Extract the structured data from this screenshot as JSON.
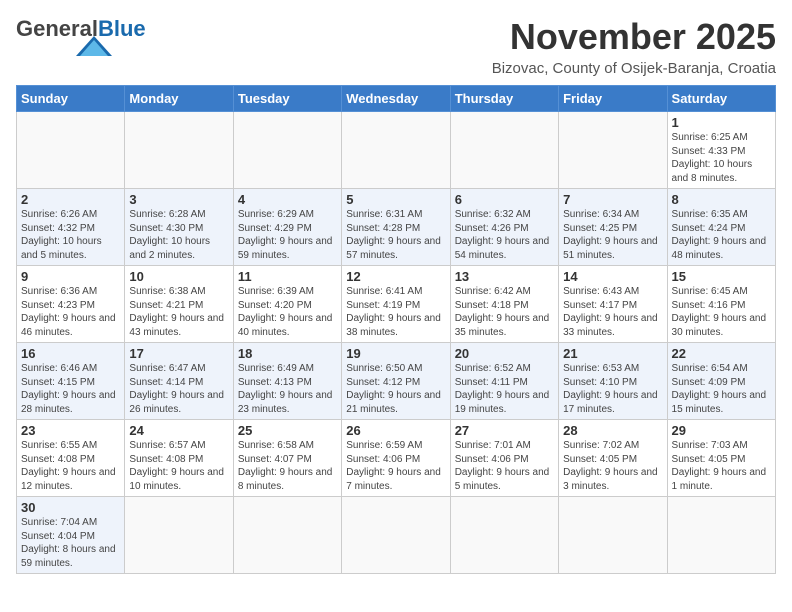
{
  "header": {
    "logo_general": "General",
    "logo_blue": "Blue",
    "month_title": "November 2025",
    "location": "Bizovac, County of Osijek-Baranja, Croatia"
  },
  "days_of_week": [
    "Sunday",
    "Monday",
    "Tuesday",
    "Wednesday",
    "Thursday",
    "Friday",
    "Saturday"
  ],
  "weeks": [
    [
      {
        "num": "",
        "info": ""
      },
      {
        "num": "",
        "info": ""
      },
      {
        "num": "",
        "info": ""
      },
      {
        "num": "",
        "info": ""
      },
      {
        "num": "",
        "info": ""
      },
      {
        "num": "",
        "info": ""
      },
      {
        "num": "1",
        "info": "Sunrise: 6:25 AM\nSunset: 4:33 PM\nDaylight: 10 hours and 8 minutes."
      }
    ],
    [
      {
        "num": "2",
        "info": "Sunrise: 6:26 AM\nSunset: 4:32 PM\nDaylight: 10 hours and 5 minutes."
      },
      {
        "num": "3",
        "info": "Sunrise: 6:28 AM\nSunset: 4:30 PM\nDaylight: 10 hours and 2 minutes."
      },
      {
        "num": "4",
        "info": "Sunrise: 6:29 AM\nSunset: 4:29 PM\nDaylight: 9 hours and 59 minutes."
      },
      {
        "num": "5",
        "info": "Sunrise: 6:31 AM\nSunset: 4:28 PM\nDaylight: 9 hours and 57 minutes."
      },
      {
        "num": "6",
        "info": "Sunrise: 6:32 AM\nSunset: 4:26 PM\nDaylight: 9 hours and 54 minutes."
      },
      {
        "num": "7",
        "info": "Sunrise: 6:34 AM\nSunset: 4:25 PM\nDaylight: 9 hours and 51 minutes."
      },
      {
        "num": "8",
        "info": "Sunrise: 6:35 AM\nSunset: 4:24 PM\nDaylight: 9 hours and 48 minutes."
      }
    ],
    [
      {
        "num": "9",
        "info": "Sunrise: 6:36 AM\nSunset: 4:23 PM\nDaylight: 9 hours and 46 minutes."
      },
      {
        "num": "10",
        "info": "Sunrise: 6:38 AM\nSunset: 4:21 PM\nDaylight: 9 hours and 43 minutes."
      },
      {
        "num": "11",
        "info": "Sunrise: 6:39 AM\nSunset: 4:20 PM\nDaylight: 9 hours and 40 minutes."
      },
      {
        "num": "12",
        "info": "Sunrise: 6:41 AM\nSunset: 4:19 PM\nDaylight: 9 hours and 38 minutes."
      },
      {
        "num": "13",
        "info": "Sunrise: 6:42 AM\nSunset: 4:18 PM\nDaylight: 9 hours and 35 minutes."
      },
      {
        "num": "14",
        "info": "Sunrise: 6:43 AM\nSunset: 4:17 PM\nDaylight: 9 hours and 33 minutes."
      },
      {
        "num": "15",
        "info": "Sunrise: 6:45 AM\nSunset: 4:16 PM\nDaylight: 9 hours and 30 minutes."
      }
    ],
    [
      {
        "num": "16",
        "info": "Sunrise: 6:46 AM\nSunset: 4:15 PM\nDaylight: 9 hours and 28 minutes."
      },
      {
        "num": "17",
        "info": "Sunrise: 6:47 AM\nSunset: 4:14 PM\nDaylight: 9 hours and 26 minutes."
      },
      {
        "num": "18",
        "info": "Sunrise: 6:49 AM\nSunset: 4:13 PM\nDaylight: 9 hours and 23 minutes."
      },
      {
        "num": "19",
        "info": "Sunrise: 6:50 AM\nSunset: 4:12 PM\nDaylight: 9 hours and 21 minutes."
      },
      {
        "num": "20",
        "info": "Sunrise: 6:52 AM\nSunset: 4:11 PM\nDaylight: 9 hours and 19 minutes."
      },
      {
        "num": "21",
        "info": "Sunrise: 6:53 AM\nSunset: 4:10 PM\nDaylight: 9 hours and 17 minutes."
      },
      {
        "num": "22",
        "info": "Sunrise: 6:54 AM\nSunset: 4:09 PM\nDaylight: 9 hours and 15 minutes."
      }
    ],
    [
      {
        "num": "23",
        "info": "Sunrise: 6:55 AM\nSunset: 4:08 PM\nDaylight: 9 hours and 12 minutes."
      },
      {
        "num": "24",
        "info": "Sunrise: 6:57 AM\nSunset: 4:08 PM\nDaylight: 9 hours and 10 minutes."
      },
      {
        "num": "25",
        "info": "Sunrise: 6:58 AM\nSunset: 4:07 PM\nDaylight: 9 hours and 8 minutes."
      },
      {
        "num": "26",
        "info": "Sunrise: 6:59 AM\nSunset: 4:06 PM\nDaylight: 9 hours and 7 minutes."
      },
      {
        "num": "27",
        "info": "Sunrise: 7:01 AM\nSunset: 4:06 PM\nDaylight: 9 hours and 5 minutes."
      },
      {
        "num": "28",
        "info": "Sunrise: 7:02 AM\nSunset: 4:05 PM\nDaylight: 9 hours and 3 minutes."
      },
      {
        "num": "29",
        "info": "Sunrise: 7:03 AM\nSunset: 4:05 PM\nDaylight: 9 hours and 1 minute."
      }
    ],
    [
      {
        "num": "30",
        "info": "Sunrise: 7:04 AM\nSunset: 4:04 PM\nDaylight: 8 hours and 59 minutes."
      },
      {
        "num": "",
        "info": ""
      },
      {
        "num": "",
        "info": ""
      },
      {
        "num": "",
        "info": ""
      },
      {
        "num": "",
        "info": ""
      },
      {
        "num": "",
        "info": ""
      },
      {
        "num": "",
        "info": ""
      }
    ]
  ]
}
